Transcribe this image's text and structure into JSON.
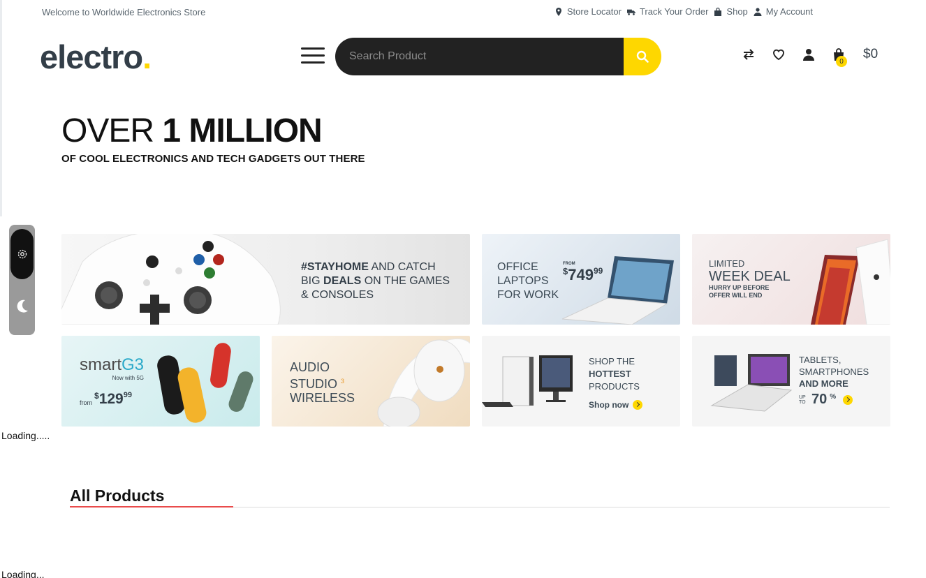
{
  "topbar": {
    "welcome": "Welcome to Worldwide Electronics Store",
    "links": [
      {
        "label": "Store Locator",
        "icon": "map-pin-icon"
      },
      {
        "label": "Track Your Order",
        "icon": "truck-icon"
      },
      {
        "label": "Shop",
        "icon": "shopping-bag-icon"
      },
      {
        "label": "My Account",
        "icon": "user-icon"
      }
    ]
  },
  "header": {
    "logo_text": "electro",
    "logo_dot": ".",
    "search_placeholder": "Search Product",
    "cart_count": "0",
    "cart_total": "$0"
  },
  "hero": {
    "title_light": "OVER ",
    "title_bold": "1 MILLION",
    "subtitle": "OF COOL ELECTRONICS AND TECH GADGETS OUT THERE"
  },
  "banners": {
    "games": {
      "tag": "#STAYHOME",
      "line1_rest": " AND CATCH",
      "line2_pre": "BIG ",
      "line2_bold": "DEALS",
      "line2_rest": " ON THE GAMES",
      "line3": "& CONSOLES"
    },
    "laptops": {
      "line1": "OFFICE",
      "line2": "LAPTOPS",
      "line3": "FOR WORK",
      "from": "FROM",
      "currency": "$",
      "price": "749",
      "cents": "99"
    },
    "week_deal": {
      "line1": "LIMITED",
      "line2": "WEEK DEAL",
      "line3": "HURRY UP BEFORE",
      "line4": "OFFER WILL END"
    },
    "smartg3": {
      "brand_a": "smart",
      "brand_b": "G3",
      "subtitle": "Now with 5G",
      "from": "from",
      "currency": "$",
      "price": "129",
      "cents": "99"
    },
    "audio": {
      "line1": "AUDIO",
      "line2": "STUDIO",
      "sup": "3",
      "line3": "WIRELESS"
    },
    "hottest": {
      "line1": "SHOP THE",
      "line2": "HOTTEST",
      "line3": "PRODUCTS",
      "cta": "Shop now"
    },
    "tablets": {
      "line1": "TABLETS,",
      "line2": "SMARTPHONES",
      "line3": "AND MORE",
      "upto": "UP TO",
      "percent": "70",
      "pct_sign": "%"
    }
  },
  "status": {
    "loading_1": "Loading.....",
    "loading_2": "Loading..."
  },
  "section": {
    "title": "All Products"
  },
  "colors": {
    "accent": "#fed700",
    "dark": "#222222",
    "text": "#333e48",
    "underline": "#e94b4b"
  }
}
